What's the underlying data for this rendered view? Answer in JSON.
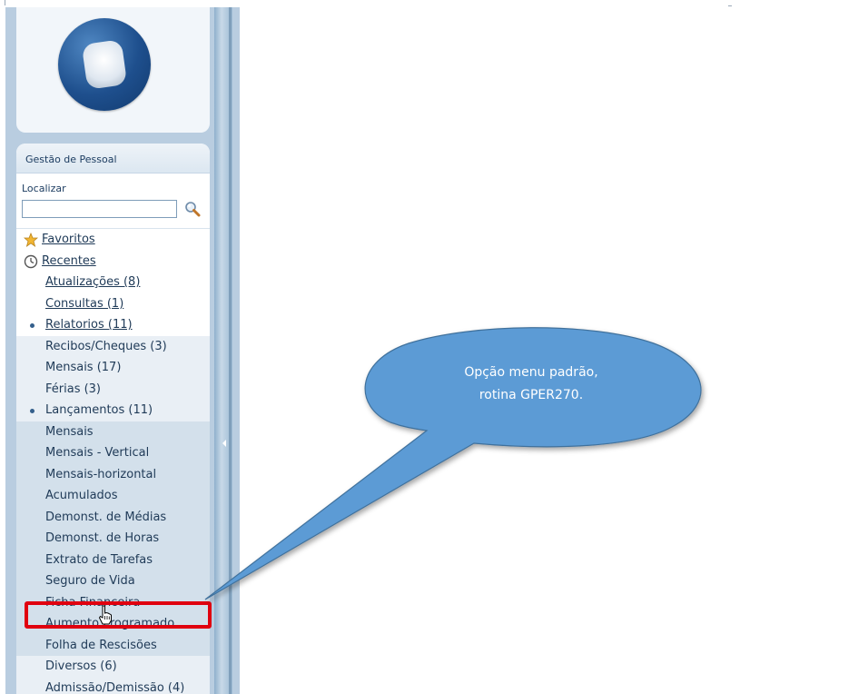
{
  "sidebar": {
    "module_title": "Gestão de Pessoal",
    "search": {
      "label": "Localizar",
      "value": "",
      "placeholder": ""
    },
    "menu": [
      {
        "label": "Favoritos",
        "icon": "star-icon",
        "level": "top",
        "bg": "white"
      },
      {
        "label": "Recentes",
        "icon": "clock-icon",
        "level": "top",
        "bg": "white"
      },
      {
        "label": "Atualizações (8)",
        "level": "l1",
        "bg": "white"
      },
      {
        "label": "Consultas (1)",
        "level": "l1",
        "bg": "white"
      },
      {
        "label": "Relatorios (11)",
        "level": "l1",
        "bullet": true,
        "bg": "white"
      },
      {
        "label": "Recibos/Cheques (3)",
        "level": "l2",
        "bg": "1"
      },
      {
        "label": "Mensais (17)",
        "level": "l2",
        "bg": "1"
      },
      {
        "label": "Férias (3)",
        "level": "l2",
        "bg": "1"
      },
      {
        "label": "Lançamentos (11)",
        "level": "l2",
        "bullet": true,
        "bg": "1"
      },
      {
        "label": "Mensais",
        "level": "l2",
        "bg": "2"
      },
      {
        "label": "Mensais - Vertical",
        "level": "l2",
        "bg": "2"
      },
      {
        "label": "Mensais-horizontal",
        "level": "l2",
        "bg": "2"
      },
      {
        "label": "Acumulados",
        "level": "l2",
        "bg": "2"
      },
      {
        "label": "Demonst. de Médias",
        "level": "l2",
        "bg": "2"
      },
      {
        "label": "Demonst. de Horas",
        "level": "l2",
        "bg": "2"
      },
      {
        "label": "Extrato de Tarefas",
        "level": "l2",
        "bg": "2"
      },
      {
        "label": "Seguro de Vida",
        "level": "l2",
        "bg": "2"
      },
      {
        "label": "Ficha Financeira",
        "level": "l2",
        "bg": "2"
      },
      {
        "label": "Aumento Programado",
        "level": "l2",
        "bg": "2"
      },
      {
        "label": "Folha de Rescisões",
        "level": "l2",
        "bg": "2"
      },
      {
        "label": "Diversos (6)",
        "level": "l2",
        "bg": "1"
      },
      {
        "label": "Admissão/Demissão (4)",
        "level": "l2",
        "bg": "1"
      }
    ]
  },
  "callout": {
    "line1": "Opção menu padrão,",
    "line2": "rotina GPER270.",
    "fill": "#5b9bd5",
    "stroke": "#41719c"
  },
  "highlight": {
    "color": "#e0000f"
  }
}
